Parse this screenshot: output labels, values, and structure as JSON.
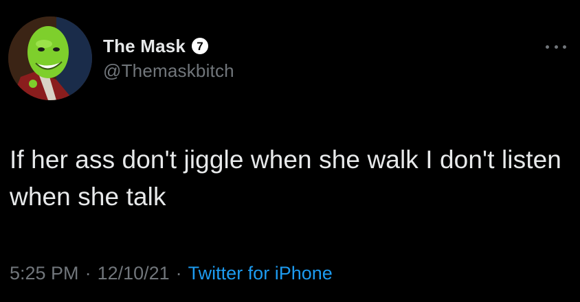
{
  "user": {
    "display_name": "The Mask",
    "handle": "@Themaskbitch",
    "badge_glyph": "7",
    "badge_color": "#ffffff",
    "badge_glyph_color": "#000000"
  },
  "tweet": {
    "text": "If her ass don't jiggle when she walk I don't listen when she talk"
  },
  "meta": {
    "time": "5:25 PM",
    "separator": "·",
    "date": "12/10/21",
    "source": "Twitter for iPhone"
  },
  "icons": {
    "more": "more-icon",
    "badge": "verified-badge-icon"
  },
  "colors": {
    "background": "#000000",
    "text": "#e7e9ea",
    "muted": "#71767b",
    "accent": "#1d9bf0"
  }
}
